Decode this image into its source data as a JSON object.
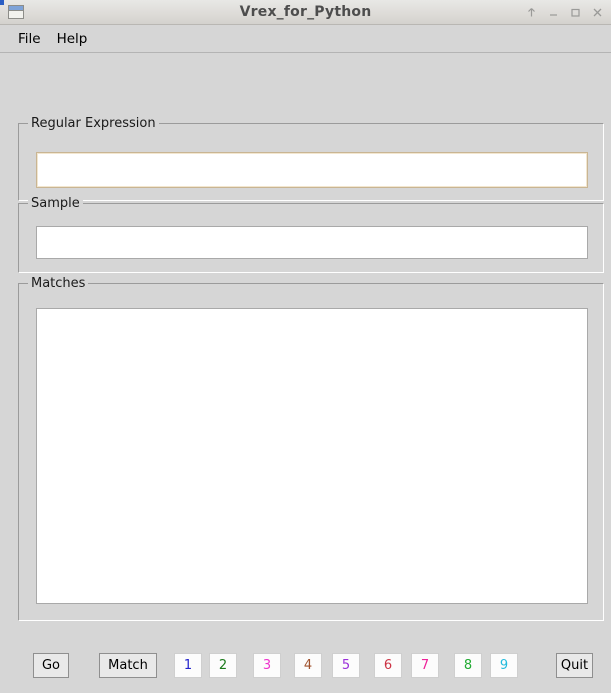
{
  "window": {
    "title": "Vrex_for_Python",
    "icon": "window-icon",
    "controls": [
      {
        "name": "shade-button",
        "glyph": "↑"
      },
      {
        "name": "minimize-button",
        "glyph": "–"
      },
      {
        "name": "maximize-button",
        "glyph": "□"
      },
      {
        "name": "close-button",
        "glyph": "✕"
      }
    ]
  },
  "menubar": {
    "items": [
      {
        "label": "File"
      },
      {
        "label": "Help"
      }
    ]
  },
  "groups": {
    "regex": {
      "title": "Regular Expression"
    },
    "sample": {
      "title": "Sample"
    },
    "matches": {
      "title": "Matches"
    }
  },
  "fields": {
    "regex": {
      "value": "",
      "placeholder": ""
    },
    "sample": {
      "value": "",
      "placeholder": ""
    },
    "matches": {
      "value": "",
      "placeholder": ""
    }
  },
  "buttons": {
    "go": {
      "label": "Go"
    },
    "match": {
      "label": "Match"
    },
    "quit": {
      "label": "Quit"
    },
    "groups": [
      {
        "label": "1",
        "color": "#2222cc"
      },
      {
        "label": "2",
        "color": "#1a7a1a"
      },
      {
        "label": "3",
        "color": "#ee33cc"
      },
      {
        "label": "4",
        "color": "#a0522d"
      },
      {
        "label": "5",
        "color": "#9b30d9"
      },
      {
        "label": "6",
        "color": "#cc3344"
      },
      {
        "label": "7",
        "color": "#ee2299"
      },
      {
        "label": "8",
        "color": "#22aa33"
      },
      {
        "label": "9",
        "color": "#22bbdd"
      }
    ]
  },
  "colors": {
    "window_bg": "#d6d6d6",
    "titlebar_bg": "#dedcd8",
    "field_bg": "#ffffff",
    "focus_border": "#c9b593",
    "normal_border": "#a9a9a9"
  }
}
